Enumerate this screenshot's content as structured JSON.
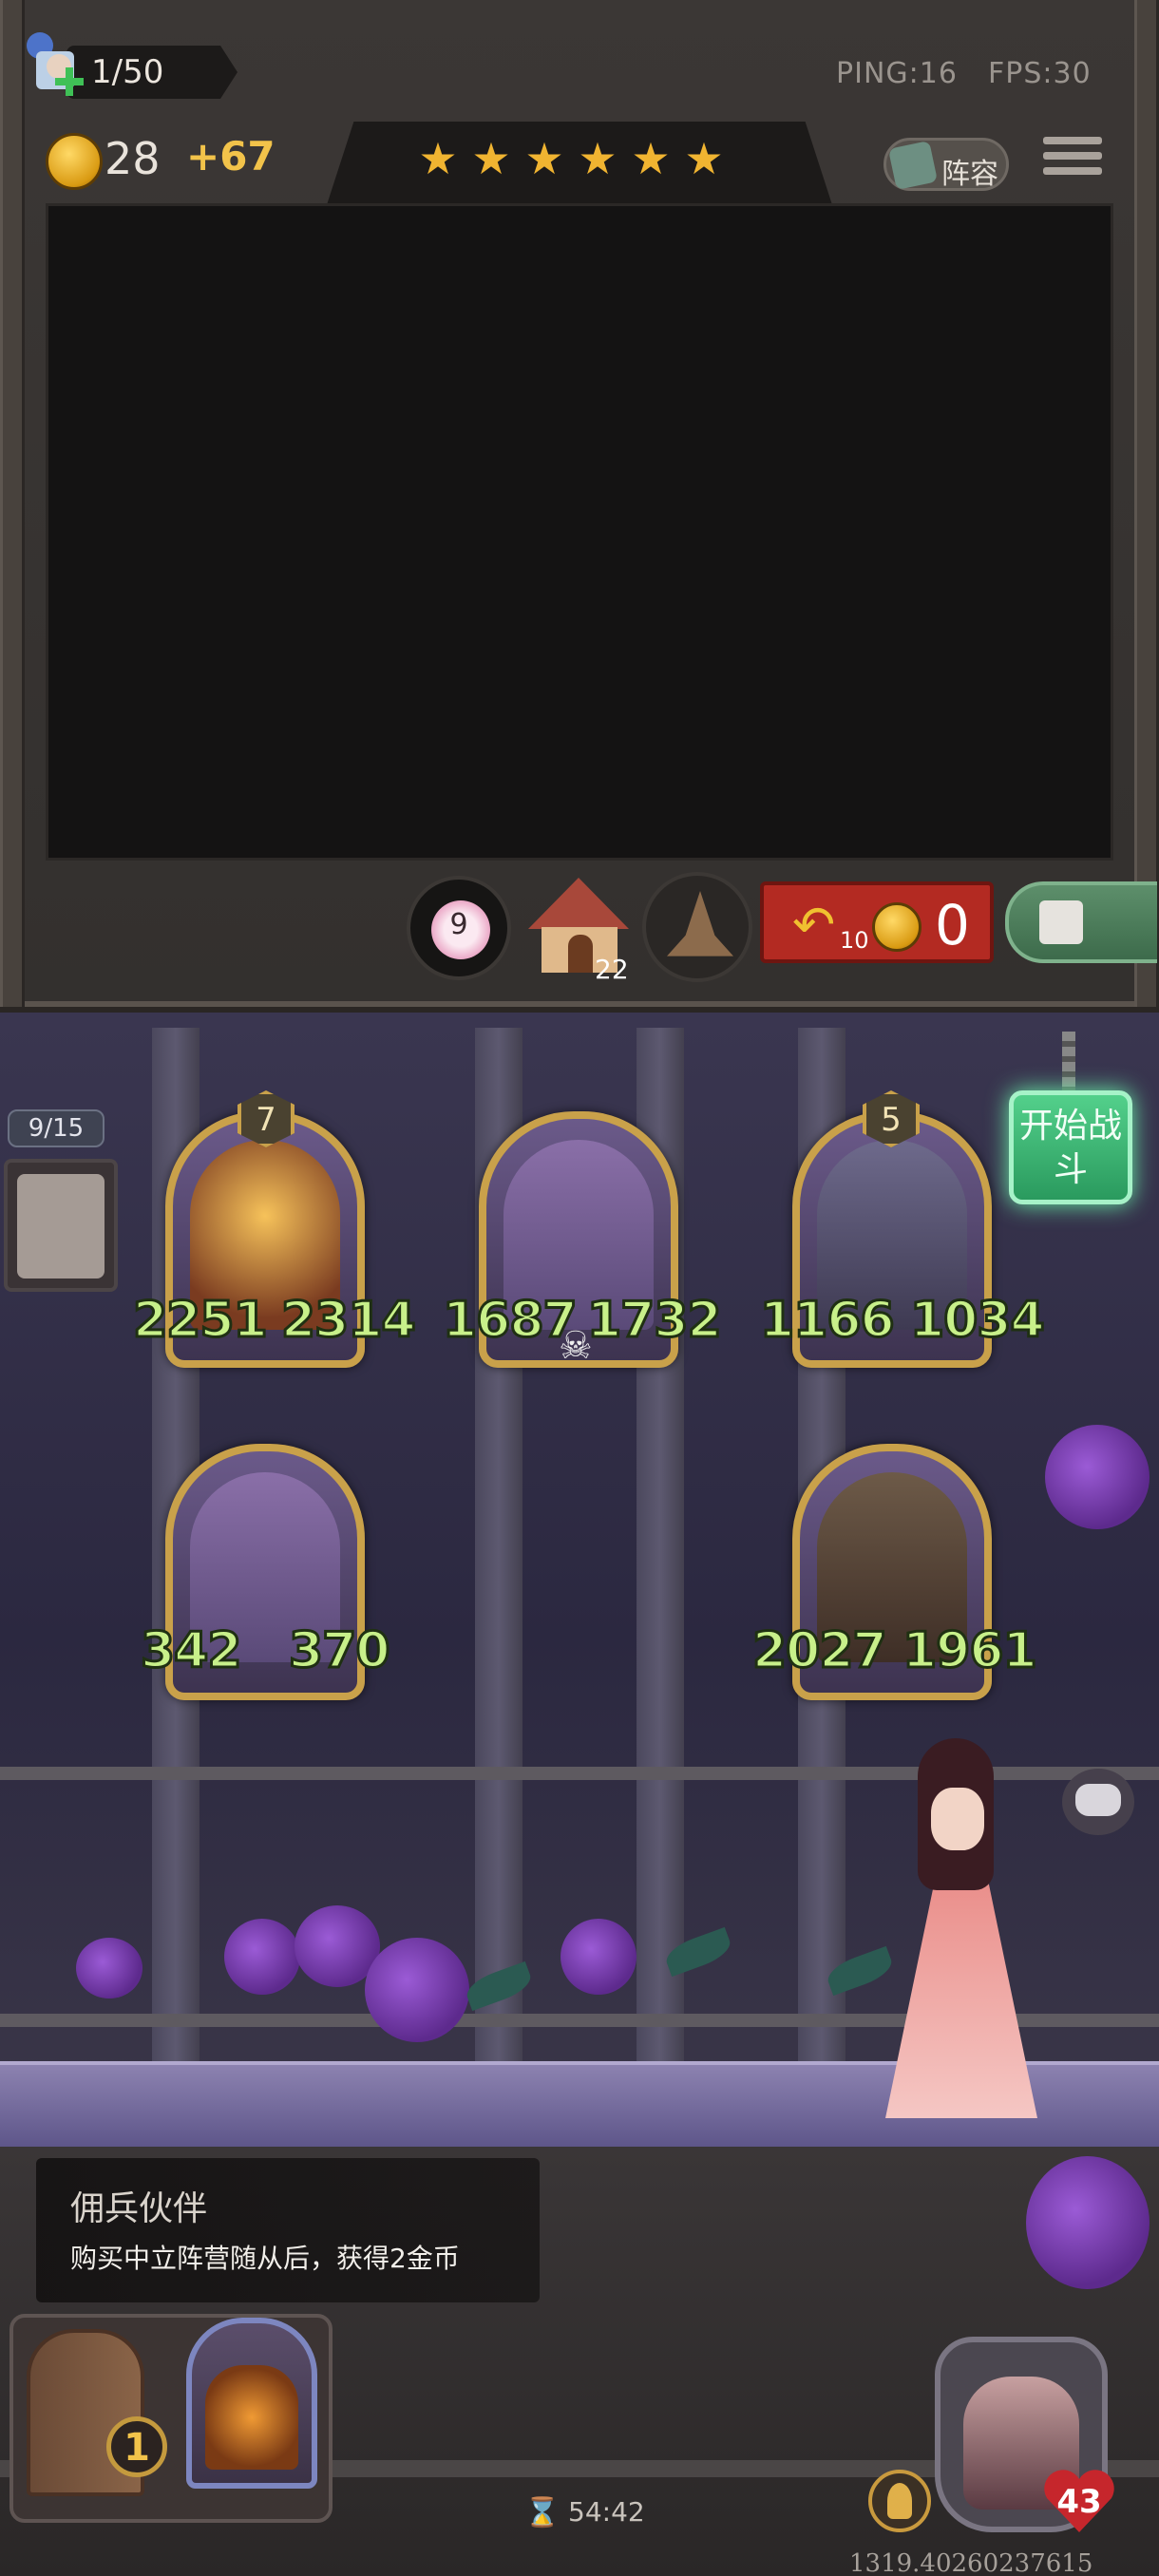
{
  "hud": {
    "player_count": "1/50",
    "ping": "PING:16",
    "fps": "FPS:30",
    "gold_amount": "28",
    "gold_income": "+67",
    "star_count": 6,
    "lineup_label": "阵容"
  },
  "controls": {
    "flower_count": "9",
    "tavern_count": "22",
    "refresh_cost": "10",
    "refresh_gold": "0"
  },
  "bench": {
    "count": "9/15"
  },
  "board": {
    "cards": [
      {
        "tier": "7",
        "attack": "2251",
        "health": "2314"
      },
      {
        "tier": "",
        "attack": "1687",
        "health": "1732"
      },
      {
        "tier": "5",
        "attack": "1166",
        "health": "1034"
      },
      {
        "tier": "",
        "attack": "342",
        "health": "370"
      },
      {
        "tier": "",
        "attack": "2027",
        "health": "1961"
      }
    ],
    "start_battle_label": "开始战斗"
  },
  "ability": {
    "title": "佣兵伙伴",
    "description": "购买中立阵营随从后，获得2金币"
  },
  "footer": {
    "hand_level": "1",
    "timer": "54:42",
    "hero_hp": "43",
    "coord_readout": "1319.40260237615"
  },
  "colors": {
    "gold": "#f2c34a",
    "stat_green": "#c8f08a",
    "start_battle": "#2a9a5e",
    "refresh_red": "#b32a22"
  }
}
